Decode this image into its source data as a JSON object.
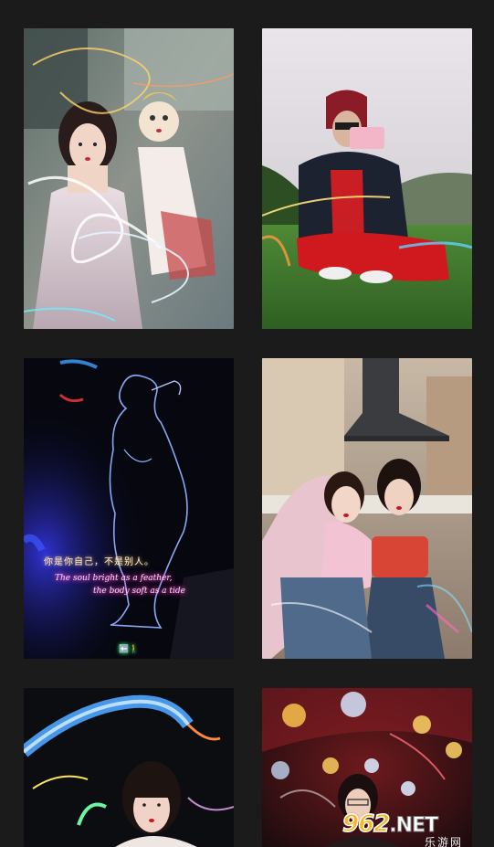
{
  "gallery": {
    "photos": [
      {
        "id": 1,
        "subject": "girl with doll, light trails"
      },
      {
        "id": 2,
        "subject": "person in red on grass hill"
      },
      {
        "id": 3,
        "subject": "neon line drawing"
      },
      {
        "id": 4,
        "subject": "two girls in kitchen"
      },
      {
        "id": 5,
        "subject": "girl with light streaks"
      },
      {
        "id": 6,
        "subject": "girl with glitter balls"
      }
    ],
    "neon_text": {
      "line1": "你是你自己，不是别人。",
      "line2": "The soul bright as a feather,",
      "line3": "the body soft as a tide"
    },
    "exit_sign": "⬅️🚶"
  },
  "watermark": {
    "number": "962",
    "suffix": ".NET",
    "chinese": "乐游网"
  },
  "colors": {
    "background": "#1b1b1c",
    "watermark_orange": "#ffb21e"
  }
}
